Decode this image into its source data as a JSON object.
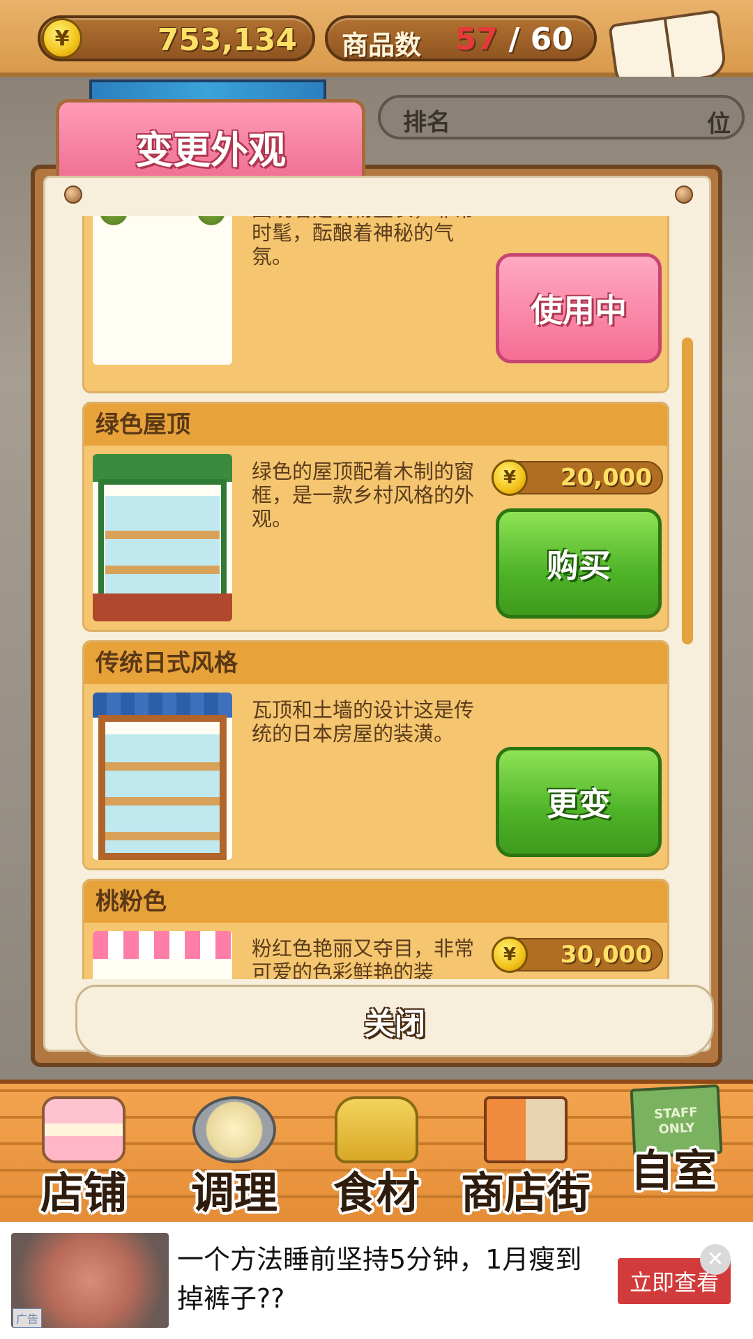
{
  "header": {
    "money": "753,134",
    "currency_symbol": "¥",
    "goods_label": "商品数",
    "goods_current": "57",
    "goods_separator": "/",
    "goods_max": "60",
    "recipe_label": "食谱"
  },
  "ranking": {
    "label": "排名",
    "unit": "位"
  },
  "panel": {
    "title": "变更外观",
    "close_label": "关闭"
  },
  "items": [
    {
      "name": "",
      "description": "围绕着建筑物生长，非常时髦，酝酿着神秘的气氛。",
      "price": "",
      "action": "使用中",
      "action_style": "pink"
    },
    {
      "name": "绿色屋顶",
      "description": "绿色的屋顶配着木制的窗框，是一款乡村风格的外观。",
      "price": "20,000",
      "action": "购买",
      "action_style": "green"
    },
    {
      "name": "传统日式风格",
      "description": "瓦顶和土墙的设计这是传统的日本房屋的装潢。",
      "price": "",
      "action": "更变",
      "action_style": "green"
    },
    {
      "name": "桃粉色",
      "description": "粉红色艳丽又夺目，非常可爱的色彩鲜艳的装",
      "price": "30,000",
      "action": "",
      "action_style": "green"
    }
  ],
  "nav": [
    {
      "label": "店铺",
      "icon": "cake-icon"
    },
    {
      "label": "调理",
      "icon": "mixing-bowl-icon"
    },
    {
      "label": "食材",
      "icon": "flour-sack-icon"
    },
    {
      "label": "商店街",
      "icon": "shop-street-icon"
    },
    {
      "label": "自室",
      "icon": "staff-only-sign-icon",
      "sign_text": "STAFF ONLY"
    }
  ],
  "ad": {
    "text": "一个方法睡前坚持5分钟，1月瘦到掉裤子??",
    "button": "立即查看",
    "tag": "广告",
    "close": "✕"
  },
  "colors": {
    "accent_green": "#4eb327",
    "accent_pink": "#f56d95",
    "gold": "#ffe066",
    "wood": "#b37742"
  }
}
